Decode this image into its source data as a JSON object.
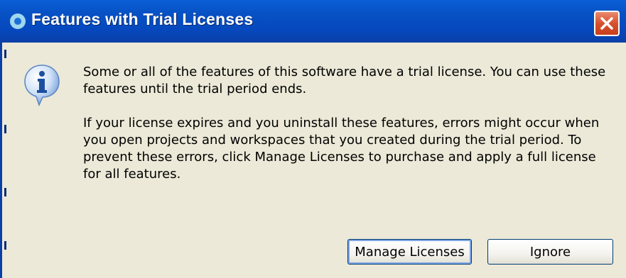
{
  "dialog": {
    "title": "Features with Trial Licenses",
    "message_paragraph_1": "Some or all of the features of this software have a trial license.  You can use these features until the trial period ends.",
    "message_paragraph_2": "If your license expires and you uninstall these features, errors might occur when you open projects and workspaces that you created during the trial period.  To prevent these errors, click Manage Licenses to purchase and apply a full license for all features.",
    "buttons": {
      "manage_label": "Manage Licenses",
      "ignore_label": "Ignore"
    }
  },
  "icons": {
    "title_icon": "app-icon",
    "close": "close-icon",
    "message_icon": "info-icon"
  },
  "colors": {
    "titlebar": "#0752c5",
    "dialog_background": "#ece9d8",
    "close_button": "#d8512f"
  }
}
